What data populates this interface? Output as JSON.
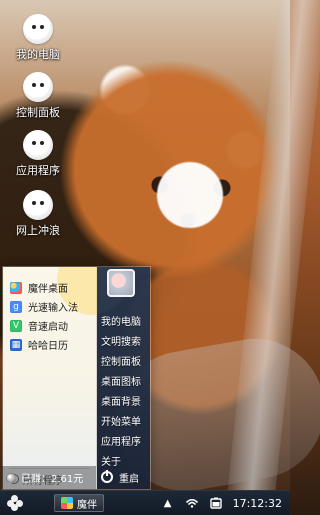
{
  "desktop": {
    "icons": [
      {
        "label": "我的电脑",
        "icon": "computer-mascot-icon"
      },
      {
        "label": "控制面板",
        "icon": "control-panel-mascot-icon"
      },
      {
        "label": "应用程序",
        "icon": "apps-mascot-icon"
      },
      {
        "label": "网上冲浪",
        "icon": "internet-mascot-icon"
      }
    ]
  },
  "start_menu": {
    "left_items": [
      {
        "label": "魔伴桌面",
        "icon": "mobanzhuomian-app-icon",
        "color": "#2fb8ff"
      },
      {
        "label": "光速输入法",
        "icon": "input-method-app-icon",
        "color": "#4a8cff"
      },
      {
        "label": "音速启动",
        "icon": "launcher-app-icon",
        "color": "#33c56a"
      },
      {
        "label": "哈哈日历",
        "icon": "calendar-app-icon",
        "color": "#2b6cd6"
      }
    ],
    "all_programs_label": "所有程序",
    "right_links": [
      "我的电脑",
      "文明搜索",
      "控制面板",
      "桌面图标",
      "桌面背景",
      "开始菜单",
      "应用程序",
      "关于"
    ],
    "restart_label": "重启"
  },
  "earned": {
    "text": "已赚：2.61元"
  },
  "taskbar": {
    "start_icon": "flower-start-icon",
    "task_label": "魔伴",
    "tray": {
      "up_arrow": "▲",
      "time": "17:12:32"
    }
  }
}
